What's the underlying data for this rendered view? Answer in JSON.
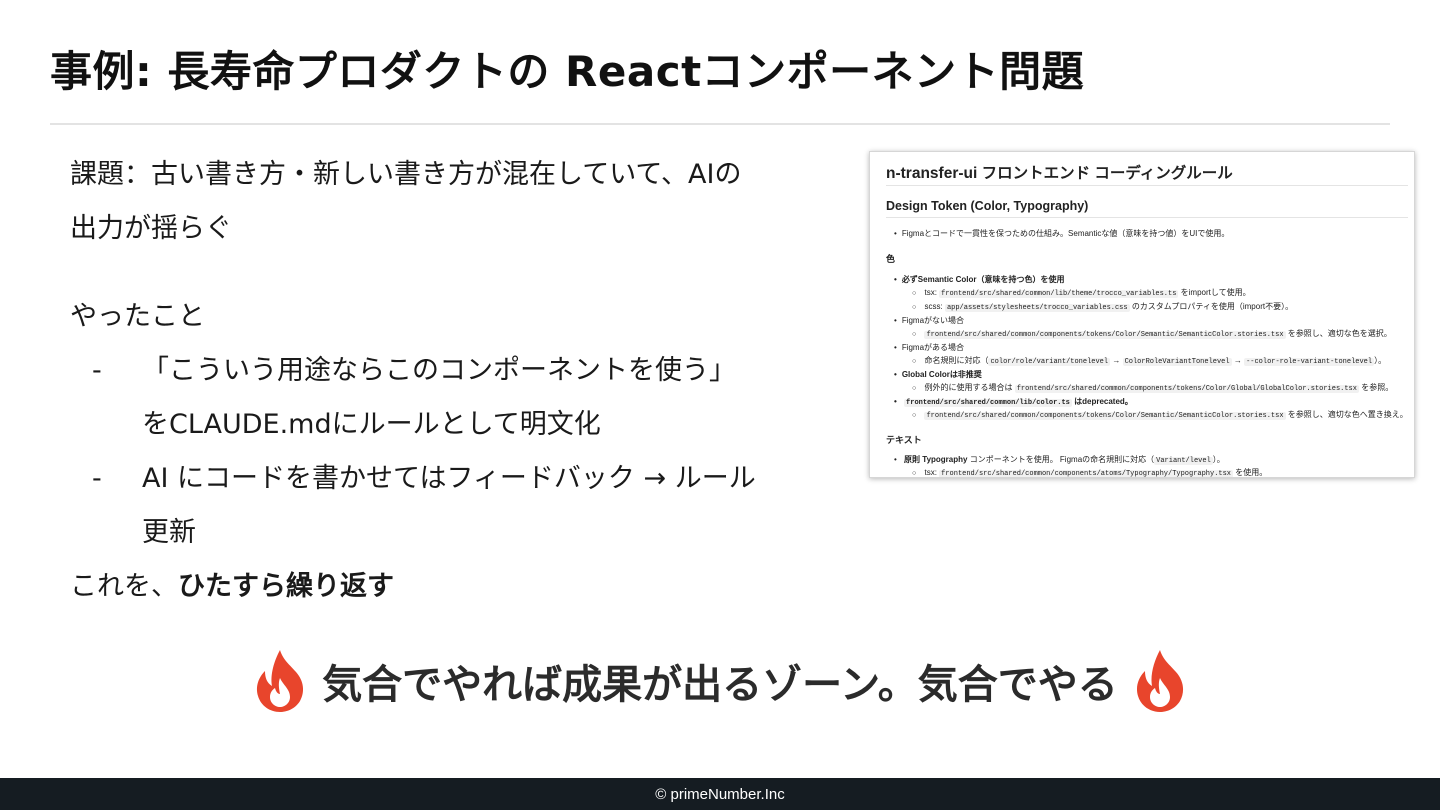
{
  "slide": {
    "title": "事例: 長寿命プロダクトの Reactコンポーネント問題",
    "issue_line1": "課題：古い書き方・新しい書き方が混在していて、AIの",
    "issue_line2": "出力が揺らぐ",
    "done_heading": "やったこと",
    "bullets": [
      {
        "dash": "-",
        "line1": "「こういう用途ならこのコンポーネントを使う」",
        "line2": "をCLAUDE.mdにルールとして明文化"
      },
      {
        "dash": "-",
        "line1": "AI にコードを書かせてはフィードバック → ルール",
        "line2": "更新"
      }
    ],
    "repeat_prefix": "これを、",
    "repeat_bold": "ひたすら繰り返す",
    "tagline": "気合でやれば成果が出るゾーン。気合でやる",
    "tagline_icon_left": "fire-icon",
    "tagline_icon_right": "fire-icon",
    "accent_color": "#e8452c"
  },
  "screenshot": {
    "title": "n-transfer-ui フロントエンド コーディングルール",
    "subtitle": "Design Token (Color, Typography)",
    "intro": "Figmaとコードで一貫性を保つための仕組み。Semanticな値（意味を持つ値）をUIで使用。",
    "color_section": "色",
    "c1": "必ずSemantic Color（意味を持つ色）を使用",
    "c1_tsx_label": "tsx:",
    "c1_tsx_code": "frontend/src/shared/common/lib/theme/trocco_variables.ts",
    "c1_tsx_after": "をimportして使用。",
    "c1_scss_label": "scss:",
    "c1_scss_code": "app/assets/stylesheets/trocco_variables.css",
    "c1_scss_after": "のカスタムプロパティを使用（import不要）。",
    "c2": "Figmaがない場合",
    "c2_code": "frontend/src/shared/common/components/tokens/Color/Semantic/SemanticColor.stories.tsx",
    "c2_after": "を参照し、適切な色を選択。",
    "c3": "Figmaがある場合",
    "c3_pre": "命名規則に対応（",
    "c3_code1": "color/role/variant/tonelevel",
    "c3_arrow1": "→",
    "c3_code2": "ColorRoleVariantTonelevel",
    "c3_arrow2": "→",
    "c3_code3": "--color-role-variant-tonelevel",
    "c3_post": "）。",
    "c4": "Global Colorは非推奨",
    "c4_pre": "例外的に使用する場合は",
    "c4_code": "frontend/src/shared/common/components/tokens/Color/Global/GlobalColor.stories.tsx",
    "c4_after": "を参照。",
    "c5_code": "frontend/src/shared/common/lib/color.ts",
    "c5_after": "はdeprecated。",
    "c5_sub_code": "frontend/src/shared/common/components/tokens/Color/Semantic/SemanticColor.stories.tsx",
    "c5_sub_after": "を参照し、適切な色へ置き換え。",
    "text_section": "テキスト",
    "t1_pre": "原則",
    "t1_bold": "Typography",
    "t1_mid": "コンポーネントを使用。 Figmaの命名規則に対応（",
    "t1_code": "Variant/level",
    "t1_post": "）。",
    "t1_tsx_label": "tsx:",
    "t1_tsx_code": "frontend/src/shared/common/components/atoms/Typography/Typography.tsx",
    "t1_tsx_after": "を使用。"
  },
  "footer": {
    "copyright": "© primeNumber.Inc"
  }
}
